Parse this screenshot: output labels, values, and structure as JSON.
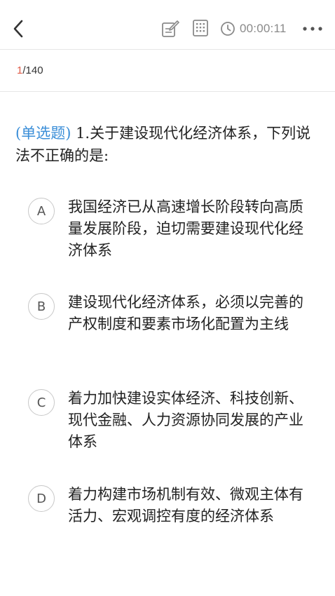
{
  "header": {
    "timer": "00:00:11",
    "icons": [
      "back-arrow-icon",
      "edit-note-icon",
      "answer-sheet-grid-icon",
      "clock-icon",
      "more-icon"
    ]
  },
  "progress": {
    "current": "1",
    "total": "/140"
  },
  "question": {
    "tag": "(单选题)",
    "text": " 1.关于建设现代化经济体系，下列说法不正确的是:"
  },
  "options": [
    {
      "letter": "A",
      "text": "我国经济已从高速增长阶段转向高质量发展阶段，迫切需要建设现代化经济体系"
    },
    {
      "letter": "B",
      "text": "建设现代化经济体系，必须以完善的产权制度和要素市场化配置为主线"
    },
    {
      "letter": "C",
      "text": "着力加快建设实体经济、科技创新、现代金融、人力资源协同发展的产业体系"
    },
    {
      "letter": "D",
      "text": "着力构建市场机制有效、微观主体有活力、宏观调控有度的经济体系"
    }
  ],
  "colors": {
    "accent_blue": "#3a8ed8",
    "counter_red": "#e05a47",
    "icon_gray": "#8a8a8a"
  }
}
